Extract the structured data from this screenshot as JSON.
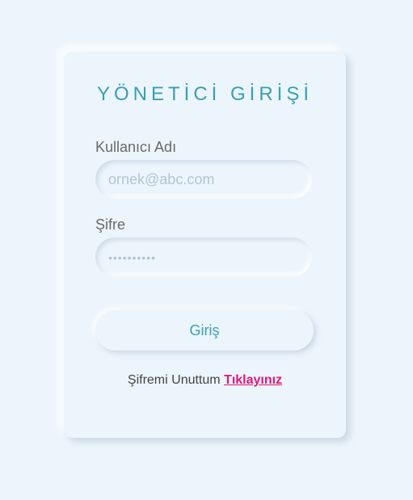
{
  "login": {
    "title": "YÖNETİCİ GİRİŞİ",
    "username_label": "Kullanıcı Adı",
    "username_placeholder": "ornek@abc.com",
    "password_label": "Şifre",
    "password_placeholder": "••••••••••",
    "submit_label": "Giriş",
    "forgot_text": "Şifremi Unuttum",
    "forgot_link": "Tıklayınız"
  },
  "colors": {
    "background": "#ecf5fc",
    "accent": "#3a9fb0",
    "link": "#e0177a"
  }
}
